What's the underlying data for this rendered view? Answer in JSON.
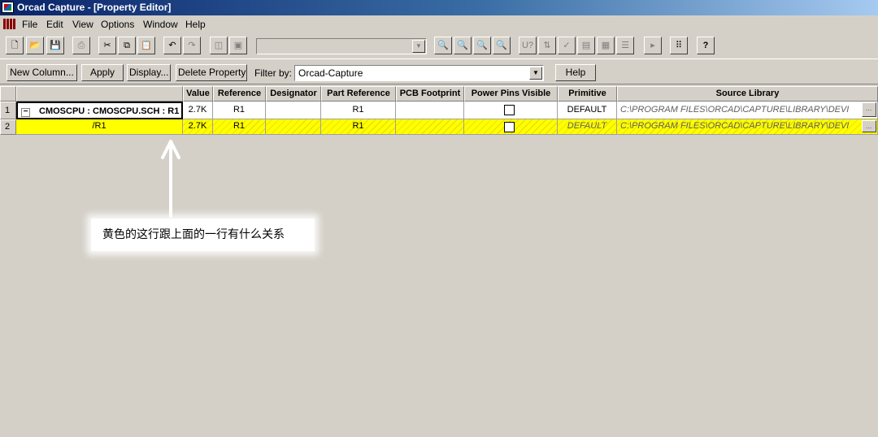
{
  "window": {
    "title": "Orcad Capture - [Property Editor]"
  },
  "menu": [
    "File",
    "Edit",
    "View",
    "Options",
    "Window",
    "Help"
  ],
  "toolbar": {
    "buttons": [
      {
        "name": "new-icon",
        "glyph": "🗋"
      },
      {
        "name": "open-icon",
        "glyph": "📂"
      },
      {
        "name": "save-icon",
        "glyph": "💾"
      },
      {
        "name": "print-icon",
        "glyph": "⎙"
      },
      {
        "name": "cut-icon",
        "glyph": "✂"
      },
      {
        "name": "copy-icon",
        "glyph": "⧉"
      },
      {
        "name": "paste-icon",
        "glyph": "📋"
      },
      {
        "name": "undo-icon",
        "glyph": "↶"
      },
      {
        "name": "redo-icon",
        "glyph": "↷"
      },
      {
        "name": "window-split-icon",
        "glyph": "◫"
      },
      {
        "name": "window-tile-icon",
        "glyph": "▣"
      },
      {
        "name": "zoom-in-icon",
        "glyph": "🔍"
      },
      {
        "name": "zoom-out-icon",
        "glyph": "🔍"
      },
      {
        "name": "zoom-area-icon",
        "glyph": "🔍"
      },
      {
        "name": "zoom-all-icon",
        "glyph": "🔍"
      },
      {
        "name": "annotate-icon",
        "glyph": "U?"
      },
      {
        "name": "back-annotate-icon",
        "glyph": "⇅"
      },
      {
        "name": "drc-icon",
        "glyph": "✓"
      },
      {
        "name": "netlist-icon",
        "glyph": "▤"
      },
      {
        "name": "cross-reference-icon",
        "glyph": "▦"
      },
      {
        "name": "bill-of-materials-icon",
        "glyph": "☰"
      },
      {
        "name": "snap-icon",
        "glyph": "▸"
      },
      {
        "name": "project-manager-icon",
        "glyph": "⠿"
      },
      {
        "name": "help-icon",
        "glyph": "?"
      }
    ]
  },
  "property_bar": {
    "new_column": "New Column...",
    "apply": "Apply",
    "display": "Display...",
    "delete_property": "Delete Property",
    "filter_label": "Filter by:",
    "filter_value": "Orcad-Capture",
    "help": "Help"
  },
  "grid": {
    "columns": [
      "Value",
      "Reference",
      "Designator",
      "Part Reference",
      "PCB Footprint",
      "Power Pins Visible",
      "Primitive",
      "Source Library"
    ],
    "rows": [
      {
        "num": "1",
        "name": "CMOSCPU : CMOSCPU.SCH : R1",
        "value": "2.7K",
        "reference": "R1",
        "designator": "",
        "part_reference": "R1",
        "pcb_footprint": "",
        "primitive": "DEFAULT",
        "source_library": "C:\\PROGRAM FILES\\ORCAD\\CAPTURE\\LIBRARY\\DEVI"
      },
      {
        "num": "2",
        "name": "/R1",
        "value": "2.7K",
        "reference": "R1",
        "designator": "",
        "part_reference": "R1",
        "pcb_footprint": "",
        "primitive": "DEFAULT",
        "source_library": "C:\\PROGRAM FILES\\ORCAD\\CAPTURE\\LIBRARY\\DEVI"
      }
    ],
    "ellipsis": "..."
  },
  "annotation": {
    "text": "黄色的这行跟上面的一行有什么关系"
  },
  "colors": {
    "selected_row": "#ffff00",
    "title_start": "#0a246a",
    "title_end": "#a6caf0"
  }
}
